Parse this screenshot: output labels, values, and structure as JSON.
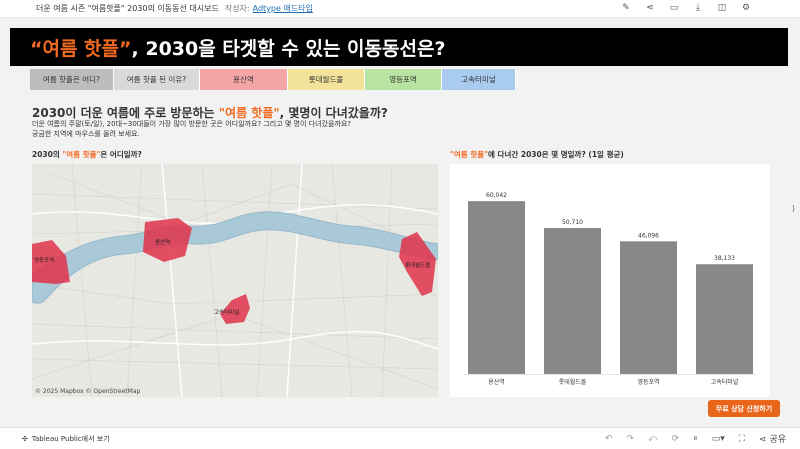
{
  "topbar": {
    "title": "더운 여름 시즌 \"여름핫플\" 2030의 이동동선 대시보드",
    "author_label": "작성자:",
    "author": "Adtype 애드타입",
    "icons": [
      "edit-icon",
      "share-icon",
      "comment-icon",
      "download-icon",
      "chat-icon",
      "settings-icon"
    ]
  },
  "hero": {
    "accent": "“여름 핫플”",
    "rest": ", 2030을 타겟할 수 있는 이동동선은?"
  },
  "tabs": [
    {
      "label": "여름 핫플은 어디?",
      "color": "#bdbdbd"
    },
    {
      "label": "여름 핫플 된 이유?",
      "color": "#d9d9d9"
    },
    {
      "label": "용산역",
      "color": "#f4a6a6"
    },
    {
      "label": "롯데월드몰",
      "color": "#f3e39a"
    },
    {
      "label": "영등포역",
      "color": "#b9e3a3"
    },
    {
      "label": "고속터미널",
      "color": "#a9cbef"
    }
  ],
  "heading": {
    "pre": "2030이 더운 여름에 주로 방문하는 ",
    "accent": "\"여름 핫플\"",
    "post": ", 몇명이 다녀갔을까?"
  },
  "description": {
    "line1": "더운 여름의 주말(토/일), 20대~30대들이 가장 많이 방문한 곳은 어디일까요? 그리고 몇 명이 다녀갔을까요?",
    "line2": "궁금한 지역에 마우스를 올려 보세요."
  },
  "map": {
    "title_pre": "2030의 ",
    "title_accent": "\"여름 핫플\"",
    "title_post": "은 어디일까?",
    "attribution": "© 2025 Mapbox  © OpenStreetMap",
    "regions": [
      {
        "label": "용산역"
      },
      {
        "label": "영등포역"
      },
      {
        "label": "롯데월드몰"
      },
      {
        "label": "고속터미널"
      }
    ],
    "river_color": "#a9c8d8",
    "region_color": "#e0334a"
  },
  "bars": {
    "title_accent": "\"여름 핫플\"",
    "title_post": "에 다녀간 2030은 몇 명일까? (1일 평균)"
  },
  "chart_data": {
    "type": "bar",
    "categories": [
      "용산역",
      "롯데월드몰",
      "영등포역",
      "고속터미널"
    ],
    "values": [
      60042,
      50710,
      46096,
      38133
    ],
    "value_labels": [
      "60,042",
      "50,710",
      "46,096",
      "38,133"
    ],
    "ylim": [
      0,
      66000
    ],
    "bar_color": "#888888",
    "grid": false
  },
  "cta": {
    "label": "무료 상담 신청하기",
    "color": "#e8651a"
  },
  "bottombar": {
    "tableau_label": "Tableau Public에서 보기",
    "share_label": "공유"
  }
}
